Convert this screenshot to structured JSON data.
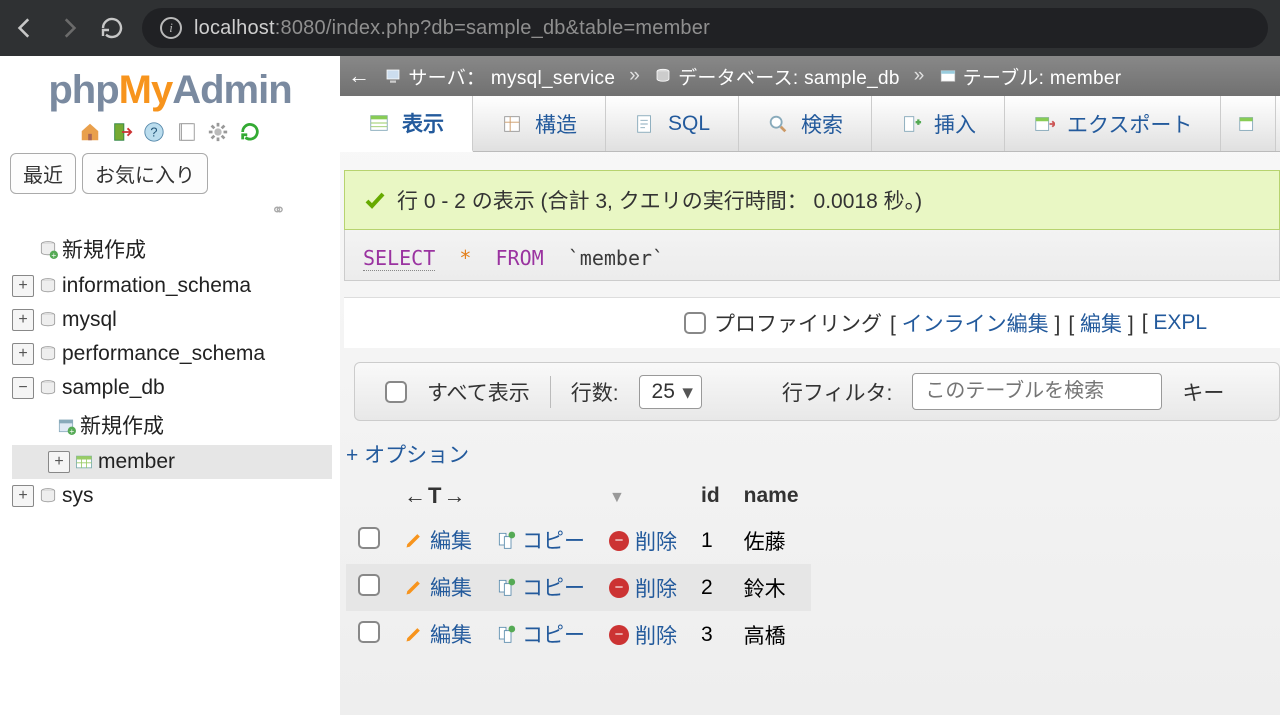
{
  "browser": {
    "url_host": "localhost",
    "url_port": ":8080",
    "url_path": "/index.php?db=sample_db&table=member"
  },
  "logo": {
    "p1": "php",
    "p2": "My",
    "p3": "Admin"
  },
  "sidebar": {
    "tab_recent": "最近",
    "tab_fav": "お気に入り",
    "nodes": {
      "new": "新規作成",
      "info_schema": "information_schema",
      "mysql": "mysql",
      "perf_schema": "performance_schema",
      "sample_db": "sample_db",
      "sample_new": "新規作成",
      "member": "member",
      "sys": "sys"
    }
  },
  "breadcrumb": {
    "server_label": "サーバ：",
    "server": "mysql_service",
    "db_label": "データベース:",
    "db": "sample_db",
    "table_label": "テーブル:",
    "table": "member",
    "sep": "»"
  },
  "tabs": {
    "browse": "表示",
    "structure": "構造",
    "sql": "SQL",
    "search": "検索",
    "insert": "挿入",
    "export": "エクスポート"
  },
  "success": "行 0 - 2 の表示 (合計 3, クエリの実行時間： 0.0018 秒。)",
  "query": {
    "select": "SELECT",
    "star": "*",
    "from": "FROM",
    "ident": "`member`"
  },
  "query_actions": {
    "profiling": "プロファイリング",
    "inline_edit": "インライン編集",
    "edit": "編集",
    "explain": "EXPL"
  },
  "tctrl": {
    "show_all": "すべて表示",
    "rows_label": "行数:",
    "rows_value": "25",
    "filter_label": "行フィルタ:",
    "filter_placeholder": "このテーブルを検索",
    "key_label": "キー"
  },
  "options_link": "+ オプション",
  "table": {
    "arrow_header": "←T→",
    "col_id": "id",
    "col_name": "name",
    "edit": "編集",
    "copy": "コピー",
    "delete": "削除",
    "rows": [
      {
        "id": "1",
        "name": "佐藤"
      },
      {
        "id": "2",
        "name": "鈴木"
      },
      {
        "id": "3",
        "name": "高橋"
      }
    ]
  }
}
